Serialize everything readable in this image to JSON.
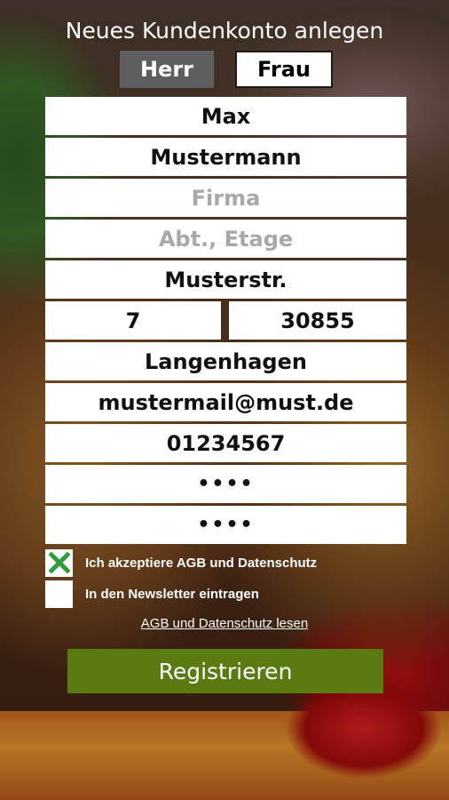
{
  "header": {
    "title": "Neues Kundenkonto anlegen"
  },
  "gender": {
    "mr_label": "Herr",
    "mrs_label": "Frau",
    "selected": "Frau"
  },
  "form": {
    "first_name": {
      "value": "Max",
      "placeholder": ""
    },
    "last_name": {
      "value": "Mustermann",
      "placeholder": ""
    },
    "company": {
      "value": "",
      "placeholder": "Firma"
    },
    "department": {
      "value": "",
      "placeholder": "Abt., Etage"
    },
    "street": {
      "value": "Musterstr.",
      "placeholder": ""
    },
    "house_number": {
      "value": "7",
      "placeholder": ""
    },
    "zip": {
      "value": "30855",
      "placeholder": ""
    },
    "city": {
      "value": "Langenhagen",
      "placeholder": ""
    },
    "email": {
      "value": "mustermail@must.de",
      "placeholder": ""
    },
    "phone": {
      "value": "01234567",
      "placeholder": ""
    },
    "password": {
      "value": "••••",
      "placeholder": ""
    },
    "password_repeat": {
      "value": "••••",
      "placeholder": ""
    }
  },
  "checks": {
    "agb": {
      "label": "Ich akzeptiere AGB und Datenschutz",
      "checked": true
    },
    "newsletter": {
      "label": "In den Newsletter eintragen",
      "checked": false
    }
  },
  "links": {
    "agb_read": "AGB und Datenschutz lesen"
  },
  "actions": {
    "register_label": "Registrieren"
  },
  "colors": {
    "accent": "#5a7a12",
    "check": "#2e9c3a",
    "selected_gender": "#ffffff",
    "unselected_gender": "#5e5e5e"
  },
  "icons": {
    "checkmark": "checkmark-icon"
  }
}
